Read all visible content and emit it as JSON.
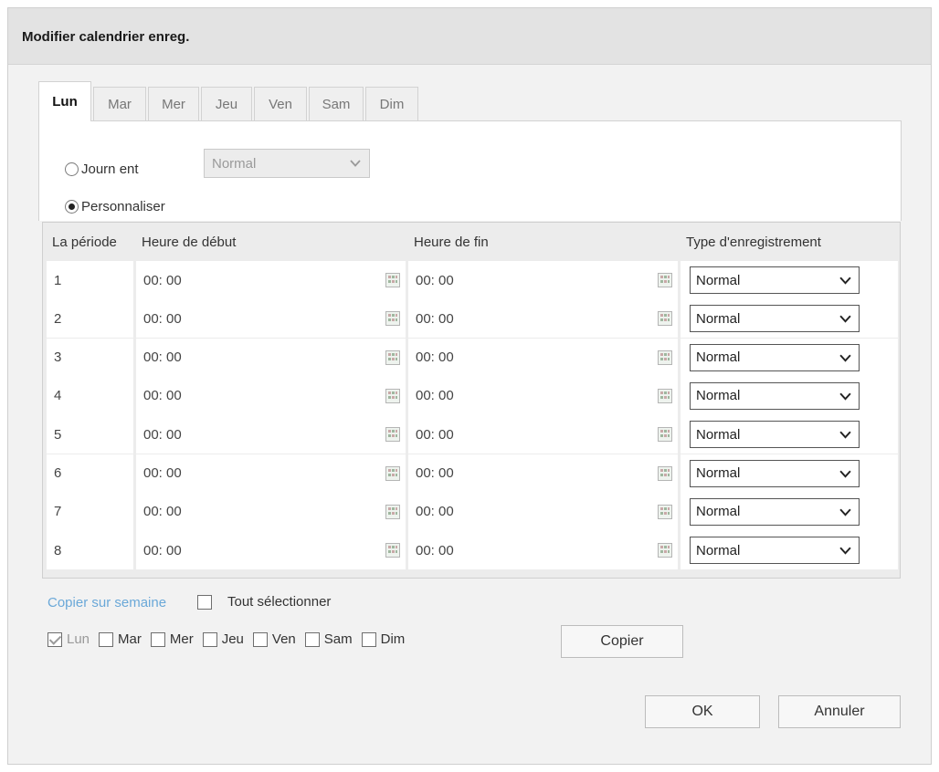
{
  "dialog": {
    "title": "Modifier calendrier enreg."
  },
  "tabs": [
    {
      "label": "Lun",
      "active": true
    },
    {
      "label": "Mar",
      "active": false
    },
    {
      "label": "Mer",
      "active": false
    },
    {
      "label": "Jeu",
      "active": false
    },
    {
      "label": "Ven",
      "active": false
    },
    {
      "label": "Sam",
      "active": false
    },
    {
      "label": "Dim",
      "active": false
    }
  ],
  "mode": {
    "whole_day_label": "Journ ent",
    "whole_day_selected": false,
    "whole_day_type": "Normal",
    "custom_label": "Personnaliser",
    "custom_selected": true
  },
  "table": {
    "headers": [
      "La période",
      "Heure de début",
      "Heure de fin",
      "Type d'enregistrement"
    ],
    "rows": [
      {
        "period": "1",
        "start": "00: 00",
        "end": "00: 00",
        "type": "Normal"
      },
      {
        "period": "2",
        "start": "00: 00",
        "end": "00: 00",
        "type": "Normal"
      },
      {
        "period": "3",
        "start": "00: 00",
        "end": "00: 00",
        "type": "Normal"
      },
      {
        "period": "4",
        "start": "00: 00",
        "end": "00: 00",
        "type": "Normal"
      },
      {
        "period": "5",
        "start": "00: 00",
        "end": "00: 00",
        "type": "Normal"
      },
      {
        "period": "6",
        "start": "00: 00",
        "end": "00: 00",
        "type": "Normal"
      },
      {
        "period": "7",
        "start": "00: 00",
        "end": "00: 00",
        "type": "Normal"
      },
      {
        "period": "8",
        "start": "00: 00",
        "end": "00: 00",
        "type": "Normal"
      }
    ]
  },
  "copy": {
    "link_label": "Copier sur semaine",
    "select_all_label": "Tout sélectionner",
    "select_all_checked": false,
    "days": [
      {
        "label": "Lun",
        "checked": true
      },
      {
        "label": "Mar",
        "checked": false
      },
      {
        "label": "Mer",
        "checked": false
      },
      {
        "label": "Jeu",
        "checked": false
      },
      {
        "label": "Ven",
        "checked": false
      },
      {
        "label": "Sam",
        "checked": false
      },
      {
        "label": "Dim",
        "checked": false
      }
    ],
    "copy_button": "Copier"
  },
  "footer": {
    "ok_label": "OK",
    "cancel_label": "Annuler"
  },
  "icons": {
    "time_picker": "calendar-icon",
    "dropdown": "chevron-down-icon"
  }
}
